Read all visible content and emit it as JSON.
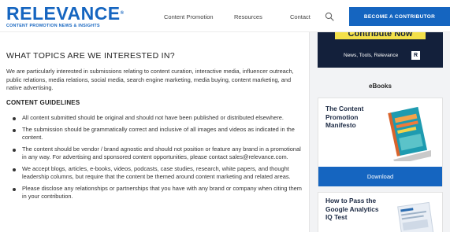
{
  "header": {
    "logo_word": "RELEVANCE",
    "logo_reg": "®",
    "logo_tagline": "CONTENT PROMOTION NEWS & INSIGHTS",
    "nav": [
      "Content Promotion",
      "Resources",
      "Contact"
    ],
    "cta_label": "BECOME A CONTRIBUTOR"
  },
  "main": {
    "heading": "WHAT TOPICS ARE WE INTERESTED IN?",
    "intro": "We are particularly interested in submissions relating to content curation, interactive media, influencer outreach, public relations, media relations, social media, search engine marketing, media buying, content marketing, and native advertising.",
    "guidelines_heading": "CONTENT GUIDELINES",
    "guidelines": [
      "All content submitted should be original and should not have been published or distributed elsewhere.",
      "The submission should be grammatically correct and inclusive of all images and videos as indicated in the content.",
      "The content should be vendor / brand agnostic and should not position or feature any brand in a promotional in any way. For advertising and sponsored content opportunities, please contact sales@relevance.com.",
      "We accept blogs, articles, e-books, videos, podcasts, case studies, research, white papers, and thought leadership columns, but require that the content be themed around content marketing and related areas.",
      "Please disclose any relationships or partnerships that you have with any brand or company when citing them in your contribution."
    ]
  },
  "sidebar": {
    "ad": {
      "headline": "Contribute Now",
      "subtext": "News, Tools, Relevance",
      "badge": "R"
    },
    "ebooks_title": "eBooks",
    "ebook1": {
      "title": "The Content Promotion Manifesto",
      "button": "Download"
    },
    "ebook2": {
      "title": "How to Pass the Google Analytics IQ Test"
    }
  },
  "colors": {
    "brand_blue": "#1565c0",
    "ad_navy": "#13203b",
    "ad_yellow": "#f3e04a",
    "sidebar_bg": "#f2f3f5"
  },
  "icons": {
    "search": "search-icon"
  }
}
